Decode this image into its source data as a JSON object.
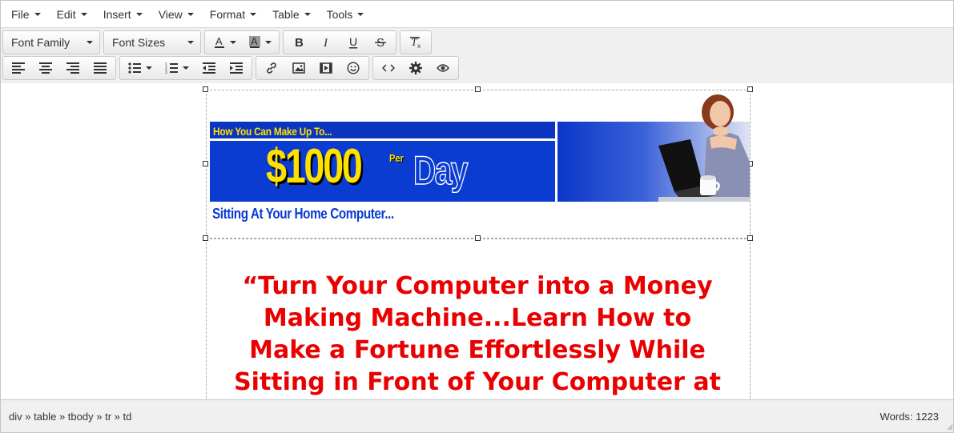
{
  "menubar": {
    "items": [
      "File",
      "Edit",
      "Insert",
      "View",
      "Format",
      "Table",
      "Tools"
    ]
  },
  "toolbar": {
    "font_family": "Font Family",
    "font_sizes": "Font Sizes",
    "icons_row1": [
      "text-color-icon",
      "background-color-icon",
      "bold-icon",
      "italic-icon",
      "underline-icon",
      "strikethrough-icon",
      "clear-formatting-icon"
    ],
    "icons_row2": [
      "align-left-icon",
      "align-center-icon",
      "align-right-icon",
      "justify-icon",
      "bullet-list-icon",
      "numbered-list-icon",
      "outdent-icon",
      "indent-icon",
      "link-icon",
      "image-icon",
      "media-icon",
      "emoticons-icon",
      "source-code-icon",
      "settings-icon",
      "preview-icon"
    ]
  },
  "content": {
    "banner_small": "How You Can Make Up To...",
    "banner_amount": "$1000",
    "banner_per": "Per",
    "banner_day": "Day",
    "banner_sub": "Sitting At Your Home Computer...",
    "headline": "“Turn Your Computer into a Money Making Machine...Learn How to Make a Fortune Effortlessly While Sitting in Front of Your Computer at"
  },
  "statusbar": {
    "path": [
      "div",
      "table",
      "tbody",
      "tr",
      "td"
    ],
    "separator": "»",
    "word_count": "Words: 1223"
  },
  "colors": {
    "headline": "#e90000",
    "banner_blue": "#0a3cd2",
    "banner_yellow": "#ffe100"
  }
}
